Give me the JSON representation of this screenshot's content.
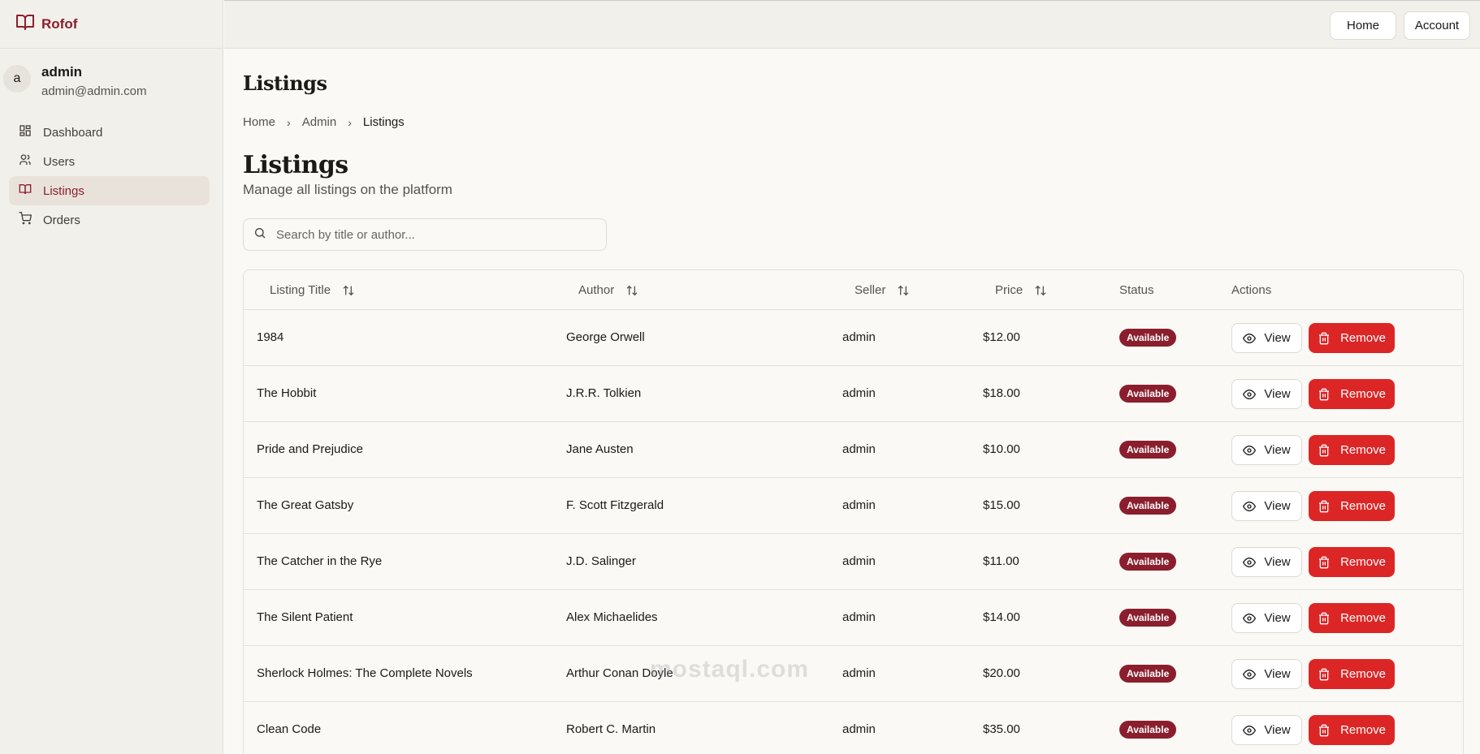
{
  "brand": {
    "name": "Rofof"
  },
  "user": {
    "initial": "a",
    "name": "admin",
    "email": "admin@admin.com"
  },
  "nav": [
    {
      "label": "Dashboard",
      "icon": "dashboard-icon"
    },
    {
      "label": "Users",
      "icon": "users-icon"
    },
    {
      "label": "Listings",
      "icon": "book-icon",
      "active": true
    },
    {
      "label": "Orders",
      "icon": "cart-icon"
    }
  ],
  "topbar": {
    "home": "Home",
    "account": "Account"
  },
  "header": {
    "title": "Listings"
  },
  "breadcrumb": [
    "Home",
    "Admin",
    "Listings"
  ],
  "page": {
    "title": "Listings",
    "subtitle": "Manage all listings on the platform"
  },
  "search": {
    "placeholder": "Search by title or author..."
  },
  "table": {
    "columns": [
      "Listing Title",
      "Author",
      "Seller",
      "Price",
      "Status",
      "Actions"
    ],
    "view_label": "View",
    "remove_label": "Remove",
    "rows": [
      {
        "title": "1984",
        "author": "George Orwell",
        "seller": "admin",
        "price": "$12.00",
        "status": "Available"
      },
      {
        "title": "The Hobbit",
        "author": "J.R.R. Tolkien",
        "seller": "admin",
        "price": "$18.00",
        "status": "Available"
      },
      {
        "title": "Pride and Prejudice",
        "author": "Jane Austen",
        "seller": "admin",
        "price": "$10.00",
        "status": "Available"
      },
      {
        "title": "The Great Gatsby",
        "author": "F. Scott Fitzgerald",
        "seller": "admin",
        "price": "$15.00",
        "status": "Available"
      },
      {
        "title": "The Catcher in the Rye",
        "author": "J.D. Salinger",
        "seller": "admin",
        "price": "$11.00",
        "status": "Available"
      },
      {
        "title": "The Silent Patient",
        "author": "Alex Michaelides",
        "seller": "admin",
        "price": "$14.00",
        "status": "Available"
      },
      {
        "title": "Sherlock Holmes: The Complete Novels",
        "author": "Arthur Conan Doyle",
        "seller": "admin",
        "price": "$20.00",
        "status": "Available"
      },
      {
        "title": "Clean Code",
        "author": "Robert C. Martin",
        "seller": "admin",
        "price": "$35.00",
        "status": "Available"
      }
    ]
  },
  "watermark": "mostaql.com",
  "colors": {
    "brand": "#8b1e2d",
    "danger": "#dc2626",
    "background": "#faf9f6",
    "sidebar": "#f2f0eb"
  }
}
